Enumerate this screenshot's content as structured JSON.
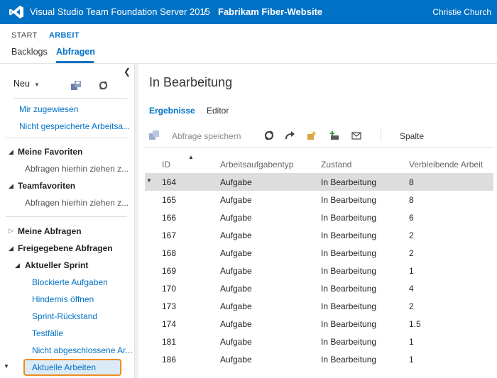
{
  "header": {
    "product": "Visual Studio Team Foundation Server 2015",
    "separator": "/",
    "project": "Fabrikam Fiber-Website",
    "user": "Christie Church",
    "logo_icon": "visual-studio-logo"
  },
  "hubs": {
    "start": "START",
    "arbeit": "ARBEIT"
  },
  "subtabs": {
    "backlogs": "Backlogs",
    "abfragen": "Abfragen"
  },
  "leftpane": {
    "neu": "Neu",
    "links": [
      "Mir zugewiesen",
      "Nicht gespeicherte Arbeitsa..."
    ],
    "favorites": {
      "title": "Meine Favoriten",
      "hint": "Abfragen hierhin ziehen z..."
    },
    "team_favorites": {
      "title": "Teamfavoriten",
      "hint": "Abfragen hierhin ziehen z..."
    },
    "my_queries": "Meine Abfragen",
    "shared_queries": "Freigegebene Abfragen",
    "current_sprint": "Aktueller Sprint",
    "sprint_items": [
      "Blockierte Aufgaben",
      "Hindernis öffnen",
      "Sprint-Rückstand",
      "Testfälle",
      "Nicht abgeschlossene Ar...",
      "Aktuelle Arbeiten"
    ]
  },
  "main": {
    "title": "In Bearbeitung",
    "tabs": {
      "results": "Ergebnisse",
      "editor": "Editor"
    },
    "toolbar": {
      "save": "Abfrage speichern",
      "columns": "Spalte"
    },
    "columns": [
      "ID",
      "Arbeitsaufgabentyp",
      "Zustand",
      "Verbleibende Arbeit"
    ],
    "rows": [
      {
        "id": "164",
        "type": "Aufgabe",
        "state": "In Bearbeitung",
        "remaining": "8"
      },
      {
        "id": "165",
        "type": "Aufgabe",
        "state": "In Bearbeitung",
        "remaining": "8"
      },
      {
        "id": "166",
        "type": "Aufgabe",
        "state": "In Bearbeitung",
        "remaining": "6"
      },
      {
        "id": "167",
        "type": "Aufgabe",
        "state": "In Bearbeitung",
        "remaining": "2"
      },
      {
        "id": "168",
        "type": "Aufgabe",
        "state": "In Bearbeitung",
        "remaining": "2"
      },
      {
        "id": "169",
        "type": "Aufgabe",
        "state": "In Bearbeitung",
        "remaining": "1"
      },
      {
        "id": "170",
        "type": "Aufgabe",
        "state": "In Bearbeitung",
        "remaining": "4"
      },
      {
        "id": "173",
        "type": "Aufgabe",
        "state": "In Bearbeitung",
        "remaining": "2"
      },
      {
        "id": "174",
        "type": "Aufgabe",
        "state": "In Bearbeitung",
        "remaining": "1.5"
      },
      {
        "id": "181",
        "type": "Aufgabe",
        "state": "In Bearbeitung",
        "remaining": "1"
      },
      {
        "id": "186",
        "type": "Aufgabe",
        "state": "In Bearbeitung",
        "remaining": "1"
      }
    ]
  },
  "colors": {
    "accent": "#0072c6",
    "highlight_border": "#f08c1e",
    "selected_row": "#dddddd"
  }
}
